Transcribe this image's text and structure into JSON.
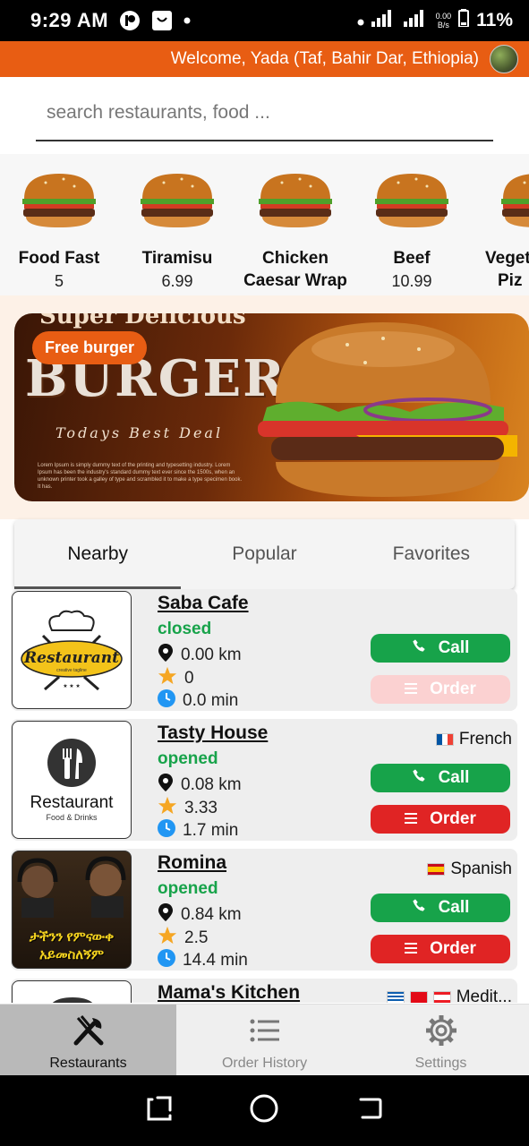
{
  "status_bar": {
    "time": "9:29 AM",
    "speed": "0.00",
    "speed_unit": "B/s",
    "battery": "11%"
  },
  "header": {
    "welcome": "Welcome, Yada (Taf, Bahir Dar, Ethiopia)"
  },
  "search": {
    "placeholder": "search restaurants, food ..."
  },
  "foods": [
    {
      "name": "Food Fast",
      "price": "5"
    },
    {
      "name": "Tiramisu",
      "price": "6.99"
    },
    {
      "name": "Chicken",
      "name2": "Caesar Wrap",
      "price": ""
    },
    {
      "name": "Beef",
      "price": "10.99"
    },
    {
      "name": "Veget",
      "name2": "Piz",
      "price": ""
    }
  ],
  "banner": {
    "top_text": "Super Delicious",
    "badge": "Free burger",
    "title": "BURGER",
    "subtitle": "Todays Best Deal",
    "body": "Lorem Ipsum is simply dummy text of the printing and typesetting industry. Lorem Ipsum has been the industry's standard dummy text ever since the 1500s, when an unknown printer took a galley of type and scrambled it to make a type specimen book. It has."
  },
  "tabs": [
    "Nearby",
    "Popular",
    "Favorites"
  ],
  "restaurants": [
    {
      "name": "Saba Cafe",
      "status": "closed",
      "status_color": "#17a34a",
      "distance": "0.00 km",
      "rating": "0",
      "time": "0.0 min",
      "cuisine": "",
      "call": "Call",
      "order": "Order",
      "order_enabled": false,
      "logo": "restaurant-creative-logo"
    },
    {
      "name": "Tasty House",
      "status": "opened",
      "status_color": "#17a34a",
      "distance": "0.08 km",
      "rating": "3.33",
      "time": "1.7 min",
      "cuisine": "French",
      "call": "Call",
      "order": "Order",
      "order_enabled": true,
      "logo": "restaurant-food-drinks-logo",
      "logo_title": "Restaurant",
      "logo_sub": "Food & Drinks"
    },
    {
      "name": "Romina",
      "status": "opened",
      "status_color": "#17a34a",
      "distance": "0.84 km",
      "rating": "2.5",
      "time": "14.4 min",
      "cuisine": "Spanish",
      "call": "Call",
      "order": "Order",
      "order_enabled": true,
      "logo": "podcast-photo",
      "logo_title": "ታችንን የምናውቀ",
      "logo_sub": "አይመስለኝም"
    },
    {
      "name": "Mama's Kitchen",
      "status": "",
      "cuisine": "Medit...",
      "logo": "restaurant-logo"
    }
  ],
  "bottom_nav": [
    {
      "label": "Restaurants",
      "icon": "fork-knife-icon",
      "active": true
    },
    {
      "label": "Order History",
      "icon": "list-icon",
      "active": false
    },
    {
      "label": "Settings",
      "icon": "gear-icon",
      "active": false
    }
  ],
  "colors": {
    "accent": "#e85d13",
    "call": "#17a34a",
    "order": "#e02424"
  }
}
